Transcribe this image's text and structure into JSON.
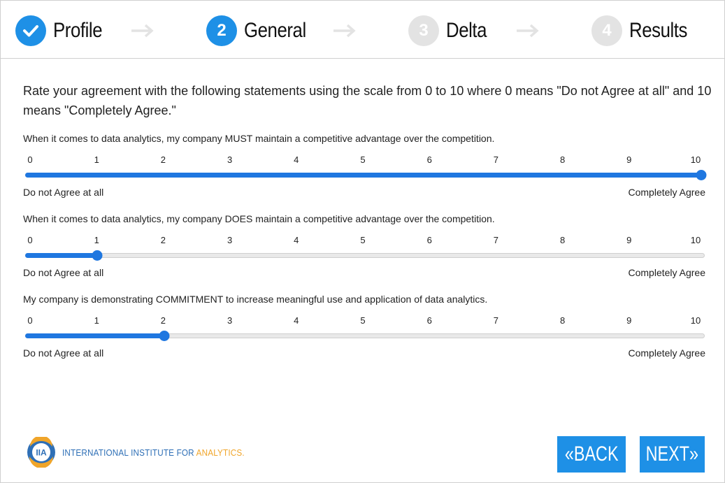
{
  "stepper": {
    "steps": [
      {
        "number": "✓",
        "label": "Profile",
        "state": "complete"
      },
      {
        "number": "2",
        "label": "General",
        "state": "current"
      },
      {
        "number": "3",
        "label": "Delta",
        "state": "upcoming"
      },
      {
        "number": "4",
        "label": "Results",
        "state": "upcoming"
      }
    ]
  },
  "intro": "Rate your agreement with the following statements using the scale from 0 to 10 where 0 means \"Do not Agree at all\" and 10 means \"Completely Agree.\"",
  "scale": {
    "ticks": [
      "0",
      "1",
      "2",
      "3",
      "4",
      "5",
      "6",
      "7",
      "8",
      "9",
      "10"
    ],
    "min": 0,
    "max": 10,
    "low_label": "Do not Agree at all",
    "high_label": "Completely Agree"
  },
  "questions": [
    {
      "text": "When it comes to data analytics, my company MUST maintain a competitive advantage over the competition.",
      "value": 10
    },
    {
      "text": "When it comes to data analytics, my company DOES maintain a competitive advantage over the competition.",
      "value": 1
    },
    {
      "text": "My company is demonstrating COMMITMENT to increase meaningful use and application of data analytics.",
      "value": 2
    }
  ],
  "footer": {
    "logo_mark": "IIA",
    "logo_text_main": "INTERNATIONAL INSTITUTE FOR ",
    "logo_text_accent": "ANALYTICS.",
    "back_label": "«BACK",
    "next_label": "NEXT»"
  },
  "colors": {
    "accent": "#1e90e6",
    "slider": "#1f77e0",
    "inactive_step": "#e3e3e3",
    "logo_blue": "#2e6fb6",
    "logo_orange": "#f0a52a"
  }
}
